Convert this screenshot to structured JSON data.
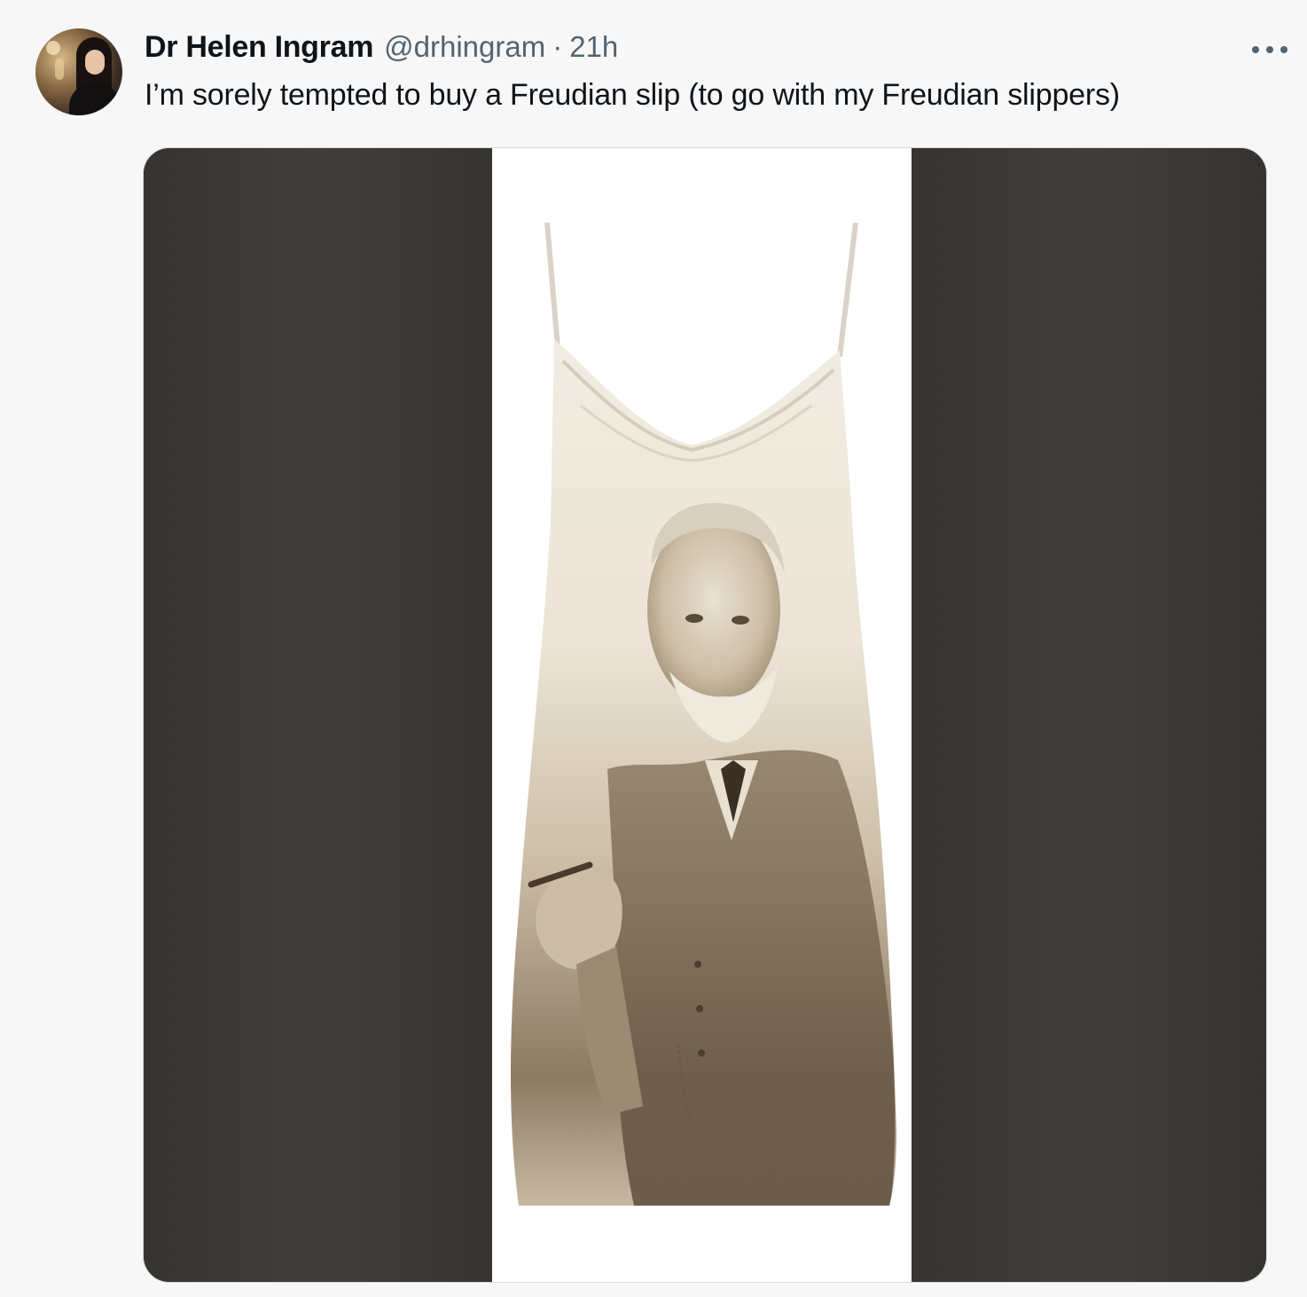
{
  "tweet": {
    "author": {
      "display_name": "Dr Helen Ingram",
      "handle": "@drhingram",
      "separator": "·",
      "time": "21h",
      "avatar_icon": "profile-photo-icon"
    },
    "more_icon": "more-options-icon",
    "text": "I’m sorely tempted to buy a Freudian slip (to go with my Freudian slippers)",
    "media": {
      "kind": "photo",
      "subject": "slip-dress-with-portrait-print",
      "side_color": "#3d3b38",
      "panel_color": "#ffffff",
      "dress_color": "#ece4d6"
    }
  },
  "colors": {
    "background": "#f7f7f7",
    "text_primary": "#0f1419",
    "text_secondary": "#536471"
  }
}
